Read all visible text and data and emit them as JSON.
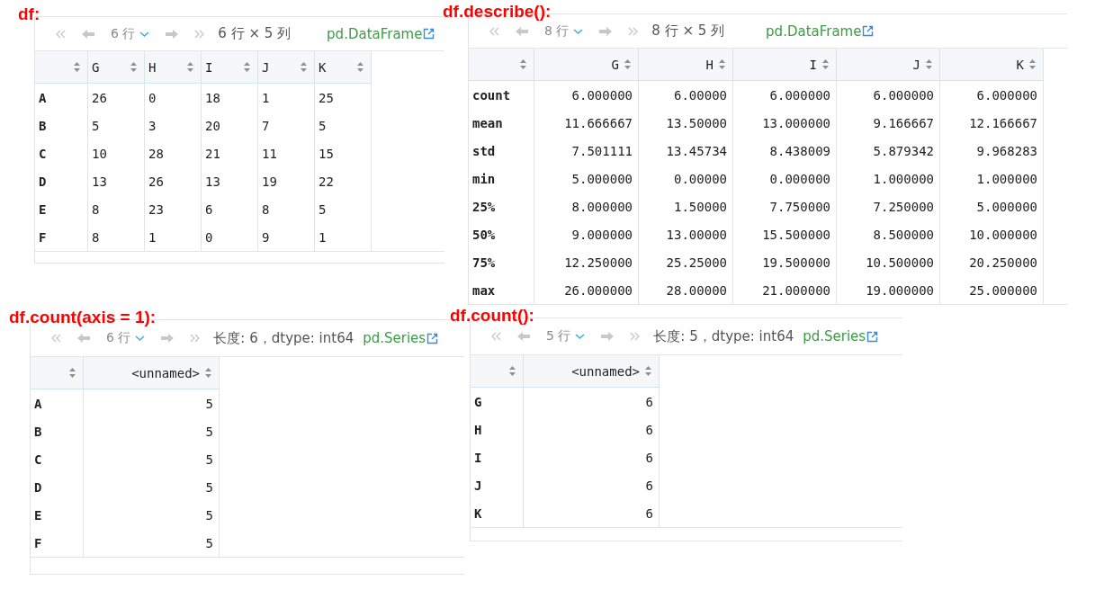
{
  "panels": [
    {
      "label": "df:",
      "toolbar": {
        "rows_selector": "6 行",
        "summary": "6 行 × 5 列",
        "type_link": "pd.DataFrame"
      },
      "table": {
        "columns": [
          "",
          "G",
          "H",
          "I",
          "J",
          "K"
        ],
        "rows": [
          [
            "A",
            "26",
            "0",
            "18",
            "1",
            "25"
          ],
          [
            "B",
            "5",
            "3",
            "20",
            "7",
            "5"
          ],
          [
            "C",
            "10",
            "28",
            "21",
            "11",
            "15"
          ],
          [
            "D",
            "13",
            "26",
            "13",
            "19",
            "22"
          ],
          [
            "E",
            "8",
            "23",
            "6",
            "8",
            "5"
          ],
          [
            "F",
            "8",
            "1",
            "0",
            "9",
            "1"
          ]
        ]
      }
    },
    {
      "label": "df.describe():",
      "toolbar": {
        "rows_selector": "8 行",
        "summary": "8 行 × 5 列",
        "type_link": "pd.DataFrame"
      },
      "table": {
        "columns": [
          "",
          "G",
          "H",
          "I",
          "J",
          "K"
        ],
        "rows": [
          [
            "count",
            "6.000000",
            "6.00000",
            "6.000000",
            "6.000000",
            "6.000000"
          ],
          [
            "mean",
            "11.666667",
            "13.50000",
            "13.000000",
            "9.166667",
            "12.166667"
          ],
          [
            "std",
            "7.501111",
            "13.45734",
            "8.438009",
            "5.879342",
            "9.968283"
          ],
          [
            "min",
            "5.000000",
            "0.00000",
            "0.000000",
            "1.000000",
            "1.000000"
          ],
          [
            "25%",
            "8.000000",
            "1.50000",
            "7.750000",
            "7.250000",
            "5.000000"
          ],
          [
            "50%",
            "9.000000",
            "13.00000",
            "15.500000",
            "8.500000",
            "10.000000"
          ],
          [
            "75%",
            "12.250000",
            "25.25000",
            "19.500000",
            "10.500000",
            "20.250000"
          ],
          [
            "max",
            "26.000000",
            "28.00000",
            "21.000000",
            "19.000000",
            "25.000000"
          ]
        ]
      }
    },
    {
      "label": "df.count(axis = 1):",
      "toolbar": {
        "rows_selector": "6 行",
        "summary": "长度: 6，dtype: int64",
        "type_link": "pd.Series"
      },
      "table": {
        "columns": [
          "",
          "<unnamed>"
        ],
        "rows": [
          [
            "A",
            "5"
          ],
          [
            "B",
            "5"
          ],
          [
            "C",
            "5"
          ],
          [
            "D",
            "5"
          ],
          [
            "E",
            "5"
          ],
          [
            "F",
            "5"
          ]
        ]
      }
    },
    {
      "label": "df.count():",
      "toolbar": {
        "rows_selector": "5 行",
        "summary": "长度: 5，dtype: int64",
        "type_link": "pd.Series"
      },
      "table": {
        "columns": [
          "",
          "<unnamed>"
        ],
        "rows": [
          [
            "G",
            "6"
          ],
          [
            "H",
            "6"
          ],
          [
            "I",
            "6"
          ],
          [
            "J",
            "6"
          ],
          [
            "K",
            "6"
          ]
        ]
      }
    }
  ]
}
